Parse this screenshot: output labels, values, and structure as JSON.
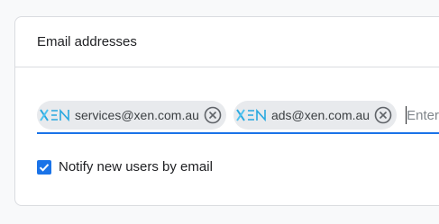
{
  "card": {
    "title": "Email addresses"
  },
  "recipients": [
    {
      "logo": "XEN",
      "email": "services@xen.com.au",
      "remove_icon": "close-circle-icon"
    },
    {
      "logo": "XEN",
      "email": "ads@xen.com.au",
      "remove_icon": "close-circle-icon"
    }
  ],
  "input": {
    "placeholder": "Enter email",
    "value": ""
  },
  "notify": {
    "checked": true,
    "label": "Notify new users by email"
  },
  "colors": {
    "accent": "#1a73e8",
    "chip_bg": "#e8eaed",
    "logo": "#29a8e0"
  }
}
